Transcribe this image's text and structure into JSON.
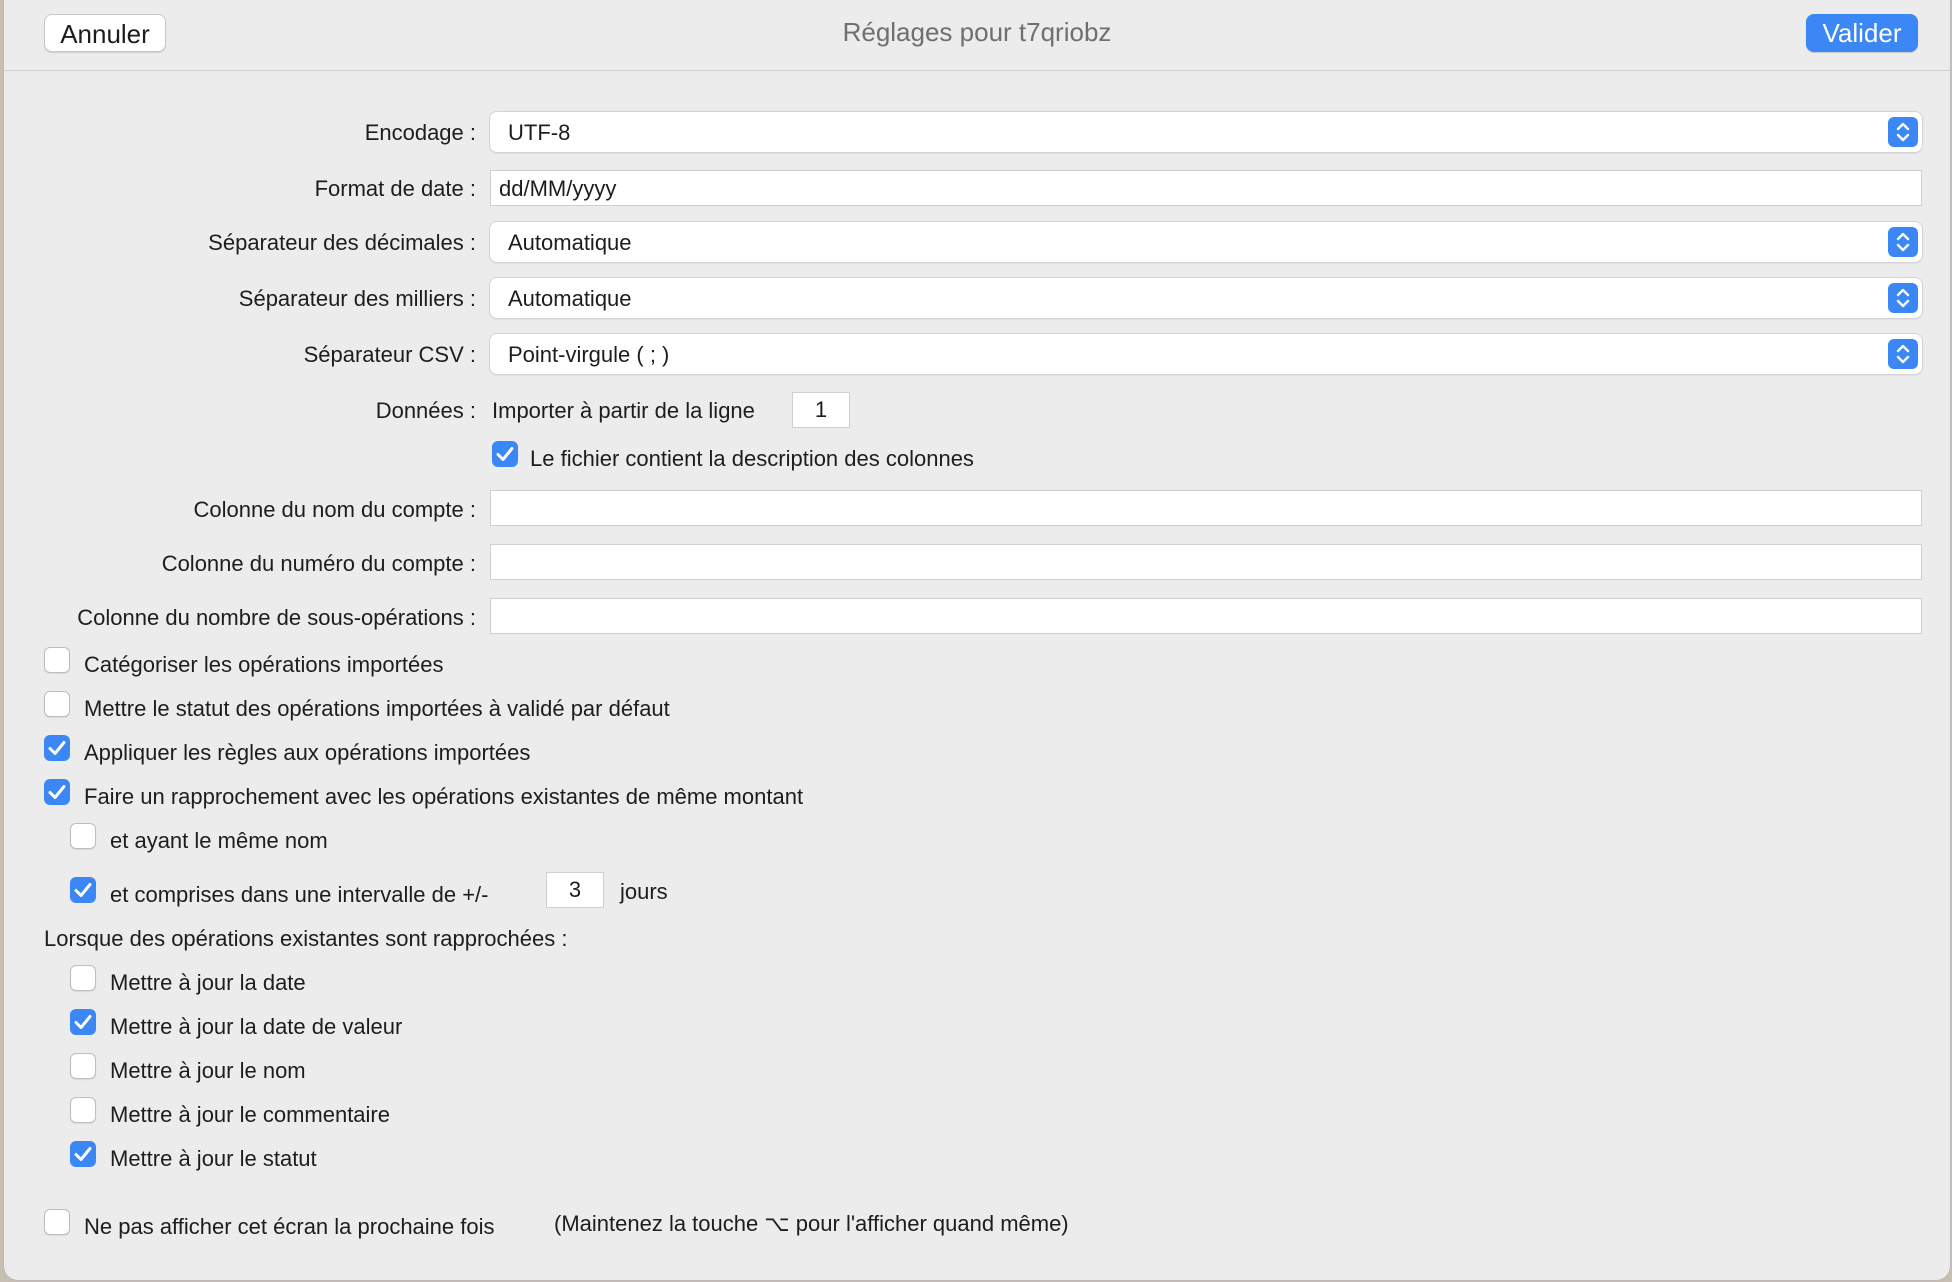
{
  "dialog": {
    "title": "Réglages pour t7qriobz",
    "cancel_label": "Annuler",
    "ok_label": "Valider"
  },
  "form": {
    "encoding": {
      "label": "Encodage :",
      "value": "UTF-8"
    },
    "date_format": {
      "label": "Format de date :",
      "value": "dd/MM/yyyy"
    },
    "decimal_separator": {
      "label": "Séparateur des décimales :",
      "value": "Automatique"
    },
    "thousands_separator": {
      "label": "Séparateur des milliers :",
      "value": "Automatique"
    },
    "csv_separator": {
      "label": "Séparateur CSV :",
      "value": "Point-virgule ( ; )"
    },
    "data": {
      "label": "Données :",
      "import_from_label": "Importer à partir de la ligne",
      "import_from_value": "1",
      "has_header_label": "Le fichier contient la description des colonnes",
      "has_header_checked": true
    },
    "account_name_col": {
      "label": "Colonne du nom du compte :",
      "value": ""
    },
    "account_number_col": {
      "label": "Colonne du numéro du compte :",
      "value": ""
    },
    "suboperations_col": {
      "label": "Colonne du nombre de sous-opérations :",
      "value": ""
    }
  },
  "options": [
    {
      "label": "Catégoriser les opérations importées",
      "checked": false
    },
    {
      "label": "Mettre le statut des opérations importées à validé par défaut",
      "checked": false
    },
    {
      "label": "Appliquer les règles aux opérations importées",
      "checked": true
    },
    {
      "label": "Faire un rapprochement avec les opérations existantes de même montant",
      "checked": true
    }
  ],
  "match": {
    "same_name": {
      "label": "et ayant le même nom",
      "checked": false
    },
    "interval": {
      "label": "et comprises dans une intervalle de +/-",
      "checked": true,
      "value": "3",
      "unit": "jours"
    }
  },
  "reconcile": {
    "heading": "Lorsque des opérations existantes sont rapprochées :",
    "items": [
      {
        "label": "Mettre à jour la date",
        "checked": false
      },
      {
        "label": "Mettre à jour la date de valeur",
        "checked": true
      },
      {
        "label": "Mettre à jour le nom",
        "checked": false
      },
      {
        "label": "Mettre à jour le commentaire",
        "checked": false
      },
      {
        "label": "Mettre à jour le statut",
        "checked": true
      }
    ]
  },
  "footer": {
    "dont_show_label": "Ne pas afficher cet écran la prochaine fois",
    "dont_show_checked": false,
    "hint": "(Maintenez la touche ⌥ pour l'afficher quand même)"
  },
  "colors": {
    "accent": "#3a87f5",
    "background": "#ececec"
  }
}
